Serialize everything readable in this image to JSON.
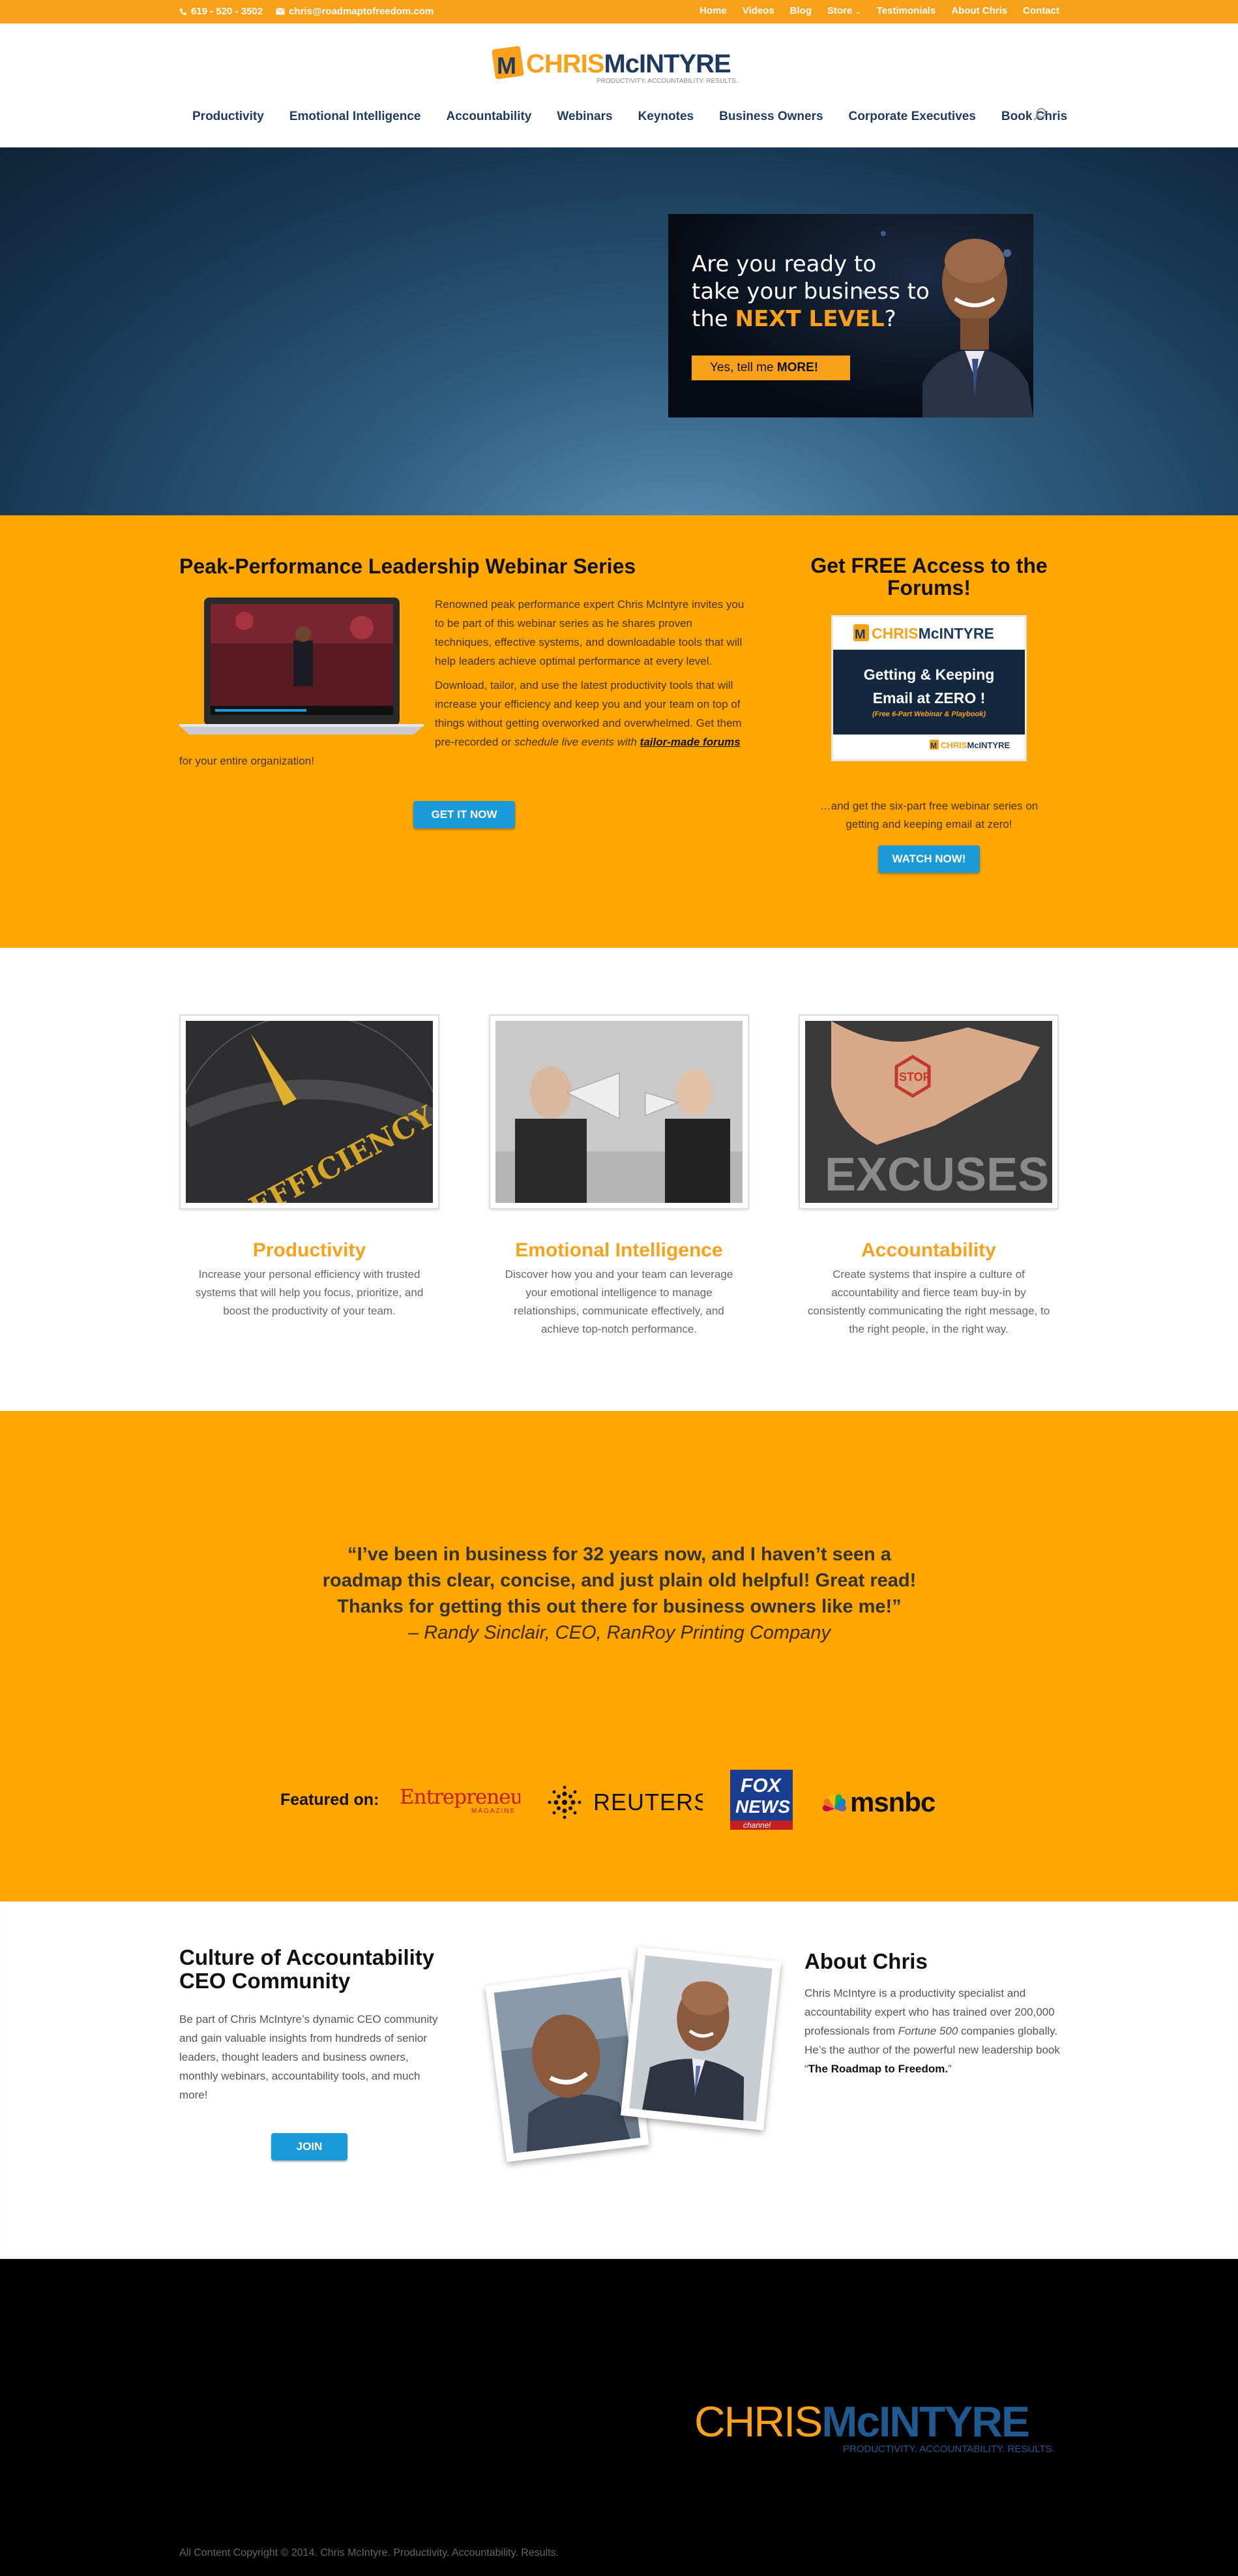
{
  "topbar": {
    "phone": "619 - 520 - 3502",
    "email": "chris@roadmaptofreedom.com",
    "nav": [
      "Home",
      "Videos",
      "Blog",
      "Store",
      "Testimonials",
      "About Chris",
      "Contact"
    ]
  },
  "logo": {
    "monogram": "M",
    "first": "CHRIS",
    "last": "McINTYRE",
    "tagline": "PRODUCTIVITY. ACCOUNTABILITY. RESULTS."
  },
  "mainnav": [
    "Productivity",
    "Emotional Intelligence",
    "Accountability",
    "Webinars",
    "Keynotes",
    "Business Owners",
    "Corporate Executives",
    "Book Chris"
  ],
  "hero": {
    "promo_line1": "Are you ready to",
    "promo_line2": "take your business to",
    "promo_line3a": "the ",
    "promo_line3b": "NEXT LEVEL",
    "promo_line3c": "?",
    "promo_button_a": "Yes, tell me ",
    "promo_button_b": "MORE!"
  },
  "webinar": {
    "title": "Peak-Performance Leadership Webinar Series",
    "p1": "Renowned peak performance expert Chris McIntyre invites you to be part of this webinar series as he shares proven techniques, effective systems, and downloadable tools that will help leaders achieve optimal performance at every level.",
    "p2a": "Download, tailor, and use the latest productivity tools that will increase your efficiency and keep you and your team on top of things without getting overworked and overwhelmed. Get them pre-recorded or ",
    "p2b": "schedule live events with ",
    "p2c": "tailor-made forums",
    "p2d": " for your entire organization!",
    "button": "GET IT NOW"
  },
  "forums": {
    "title": "Get FREE Access to the Forums!",
    "card_line1": "Getting & Keeping",
    "card_line2": "Email at ZERO !",
    "card_small": "(Free 6-Part Webinar & Playbook)",
    "caption": "…and get the six-part free webinar series on getting and keeping email at zero!",
    "button": "WATCH NOW!"
  },
  "features": [
    {
      "title": "Productivity",
      "text": "Increase your personal efficiency with trusted systems that will help you focus, prioritize, and boost the productivity of your team.",
      "image_word": "EFFICIENCY"
    },
    {
      "title": "Emotional Intelligence",
      "text": "Discover how you and your team can leverage your emotional intelligence to manage relationships, communicate effectively, and achieve top-notch performance.",
      "image_word": ""
    },
    {
      "title": "Accountability",
      "text": "Create systems that inspire a culture of accountability and fierce team buy-in by consistently communicating the right message, to the right people, in the right way.",
      "image_word": "EXCUSES",
      "sign_word": "STOP"
    }
  ],
  "testimonial": {
    "quote": "“I’ve been in business for 32 years now, and I haven’t seen a roadmap this clear, concise, and just plain old helpful! Great read! Thanks for getting this out there for business owners like me!”",
    "author": "– Randy Sinclair, CEO, RanRoy Printing Company"
  },
  "featured": {
    "label": "Featured on:",
    "entrepreneur": "Entrepreneur",
    "entrepreneur_sub": "MAGAZINE",
    "reuters": "REUTERS",
    "fox1": "FOX",
    "fox2": "NEWS",
    "fox3": "channel",
    "msnbc": "msnbc"
  },
  "community": {
    "title": "Culture of Accountability CEO Community",
    "text": "Be part of Chris McIntyre’s dynamic CEO community and gain valuable insights from hundreds of senior leaders, thought leaders and business owners, monthly webinars, accountability tools, and much more!",
    "button": "JOIN"
  },
  "about": {
    "title": "About Chris",
    "text_a": "Chris McIntyre is a productivity specialist and accountability expert who has trained over 200,000 professionals from ",
    "text_b": "Fortune 500",
    "text_c": " companies globally. He’s the author of the powerful new leadership book “",
    "text_d": "The Roadmap to Freedom.",
    "text_e": "”"
  },
  "footer": {
    "copyright": "All Content Copyright © 2014. Chris McIntyre. Productivity. Accountability. Results."
  },
  "colors": {
    "accent": "#f9a11b",
    "orange_bg": "#ffa600",
    "navy": "#1e3a5f",
    "button_blue": "#1a9bd7",
    "footer_bg": "#000000"
  }
}
